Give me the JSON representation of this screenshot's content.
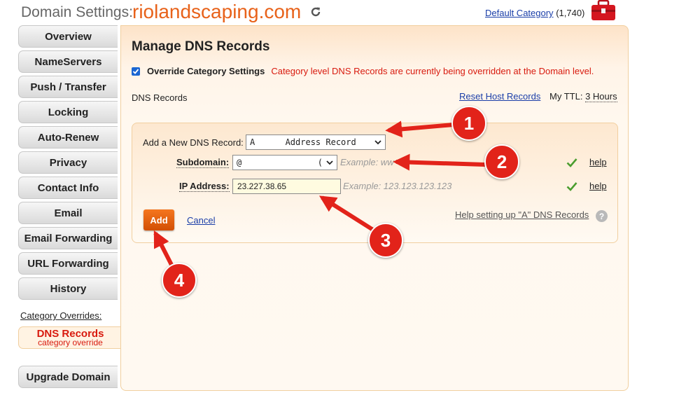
{
  "header": {
    "label": "Domain Settings:",
    "domain": "riolandscaping.com",
    "category_link": "Default Category",
    "category_count": "(1,740)"
  },
  "sidebar": {
    "items": [
      {
        "label": "Overview"
      },
      {
        "label": "NameServers"
      },
      {
        "label": "Push / Transfer"
      },
      {
        "label": "Locking"
      },
      {
        "label": "Auto-Renew"
      },
      {
        "label": "Privacy"
      },
      {
        "label": "Contact Info"
      },
      {
        "label": "Email"
      },
      {
        "label": "Email Forwarding"
      },
      {
        "label": "URL Forwarding"
      },
      {
        "label": "History"
      }
    ],
    "category_overrides_label": "Category Overrides:",
    "active_item": {
      "label": "DNS Records",
      "sublabel": "category override"
    },
    "upgrade_label": "Upgrade Domain"
  },
  "main": {
    "title": "Manage DNS Records",
    "override_label": "Override Category Settings",
    "override_message": "Category level DNS Records are currently being overridden at the Domain level.",
    "dns_records_label": "DNS Records",
    "reset_link": "Reset Host Records",
    "ttl_label": "My TTL:",
    "ttl_value": "3 Hours",
    "form": {
      "add_label": "Add a New DNS Record:",
      "record_type_value": "A      Address Record",
      "subdomain_label": "Subdomain:",
      "subdomain_value": "@",
      "subdomain_suffix": "(",
      "subdomain_example": "Example: ww",
      "ip_label": "IP Address:",
      "ip_value": "23.227.38.65",
      "ip_example": "Example: 123.123.123.123",
      "help_label": "help",
      "help_setup": "Help setting up \"A\" DNS Records",
      "question_mark": "?",
      "add_button": "Add",
      "cancel_link": "Cancel"
    }
  },
  "annotations": {
    "callouts": [
      "1",
      "2",
      "3",
      "4"
    ],
    "color": "#e2231a"
  },
  "colors": {
    "brand_orange": "#e8621a",
    "alert_red": "#d81a0e",
    "link_blue": "#1a3ea8",
    "check_green": "#4a9d2e"
  }
}
